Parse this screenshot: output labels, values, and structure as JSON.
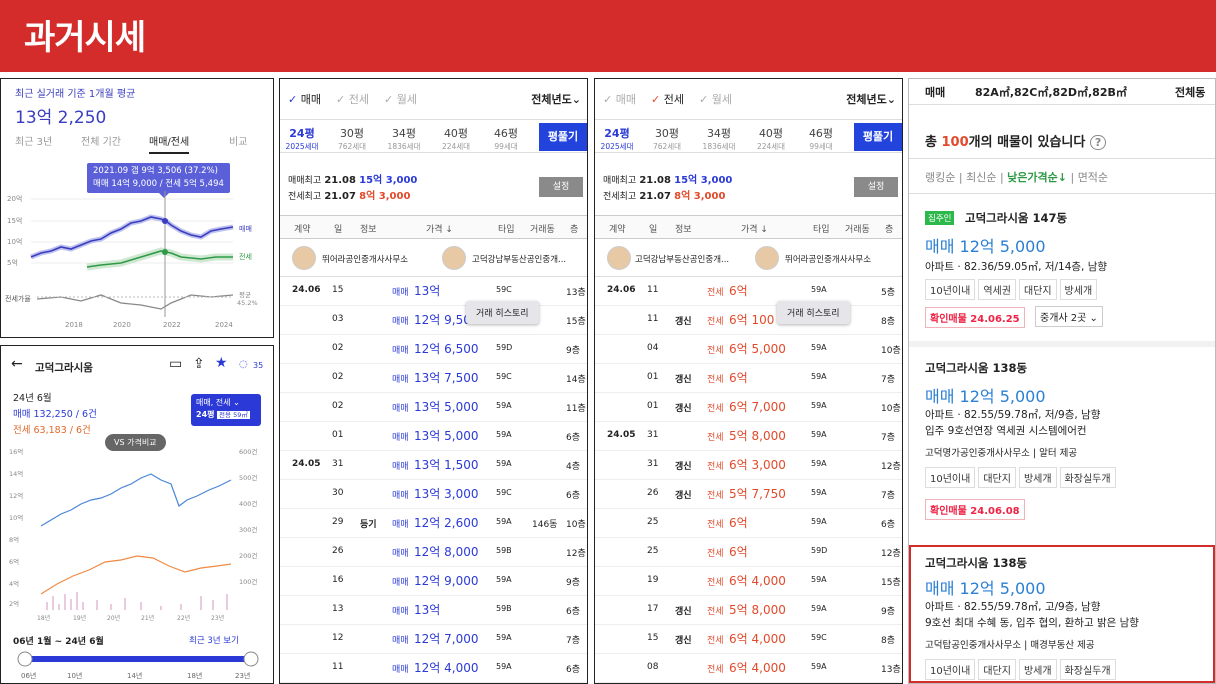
{
  "banner": {
    "title": "과거시세"
  },
  "trend": {
    "subtitle": "최근 실거래 기준 1개월 평균",
    "price": "13억 2,250",
    "tabs": [
      "최근 3년",
      "전체 기간",
      "매매/전세",
      "비교"
    ],
    "tooltip_line1": "2021.09 갭 9억 3,506 (37.2%)",
    "tooltip_line2": "매매 14억 9,000 / 전세 5억 5,494",
    "y_ticks": [
      "20억",
      "15억",
      "10억",
      "5억"
    ],
    "series_sale": "매매",
    "series_jeonse": "전세",
    "jeonse_ratio_label": "전세가율",
    "avg_label": "평균",
    "avg_value": "45.2%",
    "x_ticks": [
      "2018",
      "2020",
      "2022",
      "2024"
    ]
  },
  "complex": {
    "title": "고덕그라시움",
    "chat_count": "35",
    "month": "24년 6월",
    "sale_avg": "매매 132,250 / 6건",
    "jeonse_avg": "전세 63,183 / 6건",
    "filter_line1": "매매, 전세",
    "filter_size": "24평",
    "filter_detail": "전용 59㎡",
    "vs_label": "VS 가격비교",
    "y_left": [
      "16억",
      "14억",
      "12억",
      "10억",
      "8억",
      "6억",
      "4억",
      "2억"
    ],
    "y_right": [
      "600건",
      "500건",
      "400건",
      "300건",
      "200건",
      "100건"
    ],
    "x_ticks": [
      "18년",
      "19년",
      "20년",
      "21년",
      "22년",
      "23년"
    ],
    "range_label": "06년 1월 ~ 24년 6월",
    "recent_link": "최근 3년 보기",
    "slider_ticks": [
      "06년",
      "10년",
      "14년",
      "18년",
      "23년"
    ]
  },
  "sale_panel": {
    "tabs": [
      "매매",
      "전세",
      "월세"
    ],
    "year": "전체년도",
    "sizes": [
      {
        "a": "24평",
        "b": "2025세대"
      },
      {
        "a": "30평",
        "b": "762세대"
      },
      {
        "a": "34평",
        "b": "1836세대"
      },
      {
        "a": "40평",
        "b": "224세대"
      },
      {
        "a": "46평",
        "b": "99세대"
      }
    ],
    "size_button": "평풀기",
    "max_sale_label": "매매최고",
    "max_sale_date": "21.08",
    "max_sale_value": "15억 3,000",
    "max_jeonse_label": "전세최고",
    "max_jeonse_date": "21.07",
    "max_jeonse_value": "8억 3,000",
    "settings_button": "설정",
    "headers": [
      "계약",
      "일",
      "정보",
      "가격 ↓",
      "타입",
      "거래동",
      "층"
    ],
    "agent1": "뛰어라공인중개사사무소",
    "agent2": "고덕강남부동산공인중개...",
    "history_pill": "거래 히스토리",
    "rows": [
      {
        "m": "24.06",
        "d": "15",
        "i": "",
        "k": "매매",
        "p": "13억",
        "t": "59C",
        "g": "",
        "f": "13층"
      },
      {
        "m": "",
        "d": "03",
        "i": "",
        "k": "매매",
        "p": "12억 9,50",
        "t": "",
        "g": "",
        "f": "15층"
      },
      {
        "m": "",
        "d": "02",
        "i": "",
        "k": "매매",
        "p": "12억 6,500",
        "t": "59D",
        "g": "",
        "f": "9층"
      },
      {
        "m": "",
        "d": "02",
        "i": "",
        "k": "매매",
        "p": "13억 7,500",
        "t": "59C",
        "g": "",
        "f": "14층"
      },
      {
        "m": "",
        "d": "02",
        "i": "",
        "k": "매매",
        "p": "13억 5,000",
        "t": "59A",
        "g": "",
        "f": "11층"
      },
      {
        "m": "",
        "d": "01",
        "i": "",
        "k": "매매",
        "p": "13억 5,000",
        "t": "59A",
        "g": "",
        "f": "6층"
      },
      {
        "m": "24.05",
        "d": "31",
        "i": "",
        "k": "매매",
        "p": "13억 1,500",
        "t": "59A",
        "g": "",
        "f": "4층"
      },
      {
        "m": "",
        "d": "30",
        "i": "",
        "k": "매매",
        "p": "13억 3,000",
        "t": "59C",
        "g": "",
        "f": "6층"
      },
      {
        "m": "",
        "d": "29",
        "i": "등기",
        "k": "매매",
        "p": "12억 2,600",
        "t": "59A",
        "g": "146동",
        "f": "10층"
      },
      {
        "m": "",
        "d": "26",
        "i": "",
        "k": "매매",
        "p": "12억 8,000",
        "t": "59B",
        "g": "",
        "f": "12층"
      },
      {
        "m": "",
        "d": "16",
        "i": "",
        "k": "매매",
        "p": "12억 9,000",
        "t": "59A",
        "g": "",
        "f": "9층"
      },
      {
        "m": "",
        "d": "13",
        "i": "",
        "k": "매매",
        "p": "13억",
        "t": "59B",
        "g": "",
        "f": "6층"
      },
      {
        "m": "",
        "d": "12",
        "i": "",
        "k": "매매",
        "p": "12억 7,000",
        "t": "59A",
        "g": "",
        "f": "7층"
      },
      {
        "m": "",
        "d": "11",
        "i": "",
        "k": "매매",
        "p": "12억 4,000",
        "t": "59A",
        "g": "",
        "f": "6층"
      }
    ]
  },
  "jeonse_panel": {
    "tabs": [
      "매매",
      "전세",
      "월세"
    ],
    "year": "전체년도",
    "agent1": "고덕강남부동산공인중개...",
    "agent2": "뛰어라공인중개사사무소",
    "history_pill": "거래 히스토리",
    "rows": [
      {
        "m": "24.06",
        "d": "11",
        "i": "",
        "k": "전세",
        "p": "6억",
        "t": "59A",
        "g": "",
        "f": "5층"
      },
      {
        "m": "",
        "d": "11",
        "i": "갱신",
        "k": "전세",
        "p": "6억 100",
        "t": "",
        "g": "",
        "f": "8층"
      },
      {
        "m": "",
        "d": "04",
        "i": "",
        "k": "전세",
        "p": "6억 5,000",
        "t": "59A",
        "g": "",
        "f": "10층"
      },
      {
        "m": "",
        "d": "01",
        "i": "갱신",
        "k": "전세",
        "p": "6억",
        "t": "59A",
        "g": "",
        "f": "7층"
      },
      {
        "m": "",
        "d": "01",
        "i": "갱신",
        "k": "전세",
        "p": "6억 7,000",
        "t": "59A",
        "g": "",
        "f": "10층"
      },
      {
        "m": "24.05",
        "d": "31",
        "i": "",
        "k": "전세",
        "p": "5억 8,000",
        "t": "59A",
        "g": "",
        "f": "7층"
      },
      {
        "m": "",
        "d": "31",
        "i": "갱신",
        "k": "전세",
        "p": "6억 3,000",
        "t": "59A",
        "g": "",
        "f": "12층"
      },
      {
        "m": "",
        "d": "26",
        "i": "갱신",
        "k": "전세",
        "p": "5억 7,750",
        "t": "59A",
        "g": "",
        "f": "7층"
      },
      {
        "m": "",
        "d": "25",
        "i": "",
        "k": "전세",
        "p": "6억",
        "t": "59A",
        "g": "",
        "f": "6층"
      },
      {
        "m": "",
        "d": "25",
        "i": "",
        "k": "전세",
        "p": "6억",
        "t": "59D",
        "g": "",
        "f": "12층"
      },
      {
        "m": "",
        "d": "19",
        "i": "",
        "k": "전세",
        "p": "6억 4,000",
        "t": "59A",
        "g": "",
        "f": "15층"
      },
      {
        "m": "",
        "d": "17",
        "i": "갱신",
        "k": "전세",
        "p": "5억 8,000",
        "t": "59A",
        "g": "",
        "f": "9층"
      },
      {
        "m": "",
        "d": "15",
        "i": "갱신",
        "k": "전세",
        "p": "6억 4,000",
        "t": "59C",
        "g": "",
        "f": "8층"
      },
      {
        "m": "",
        "d": "08",
        "i": "",
        "k": "전세",
        "p": "6억 4,000",
        "t": "59A",
        "g": "",
        "f": "13층"
      }
    ]
  },
  "listings": {
    "top_type": "매매",
    "top_sizes": "82A㎡,82C㎡,82D㎡,82B㎡",
    "top_all": "전체동",
    "total_prefix": "총 ",
    "total_count": "100",
    "total_suffix": "개의 매물이 있습니다",
    "sort": [
      "랭킹순",
      "최신순",
      "낮은가격순↓",
      "면적순"
    ],
    "items": [
      {
        "badge": "집주인",
        "title": "고덕그라시움 147동",
        "price": "매매 12억 5,000",
        "desc1": "아파트 · 82.36/59.05㎡, 저/14층, 남향",
        "desc2": "",
        "agent": "",
        "tags": [
          "10년이내",
          "역세권",
          "대단지",
          "방세개"
        ],
        "confirm": "확인매물 24.06.25",
        "broker": "중개사 2곳"
      },
      {
        "badge": "",
        "title": "고덕그라시움 138동",
        "price": "매매 12억 5,000",
        "desc1": "아파트 · 82.55/59.78㎡, 저/9층, 남향",
        "desc2": "입주 9호선연장 역세권 시스템에어컨",
        "agent": "고덕명가공인중개사사무소 | 알터 제공",
        "tags": [
          "10년이내",
          "대단지",
          "방세개",
          "화장실두개"
        ],
        "confirm": "확인매물 24.06.08",
        "broker": ""
      },
      {
        "badge": "",
        "title": "고덕그라시움 138동",
        "price": "매매 12억 5,000",
        "desc1": "아파트 · 82.55/59.78㎡, 고/9층, 남향",
        "desc2": "9호선 최대 수혜 동, 입주 협의, 환하고 밝은 남향",
        "agent": "고덕탑공인중개사사무소 | 매경부동산 제공",
        "tags": [
          "10년이내",
          "대단지",
          "방세개",
          "화장실두개"
        ],
        "confirm": "",
        "broker": ""
      }
    ]
  }
}
